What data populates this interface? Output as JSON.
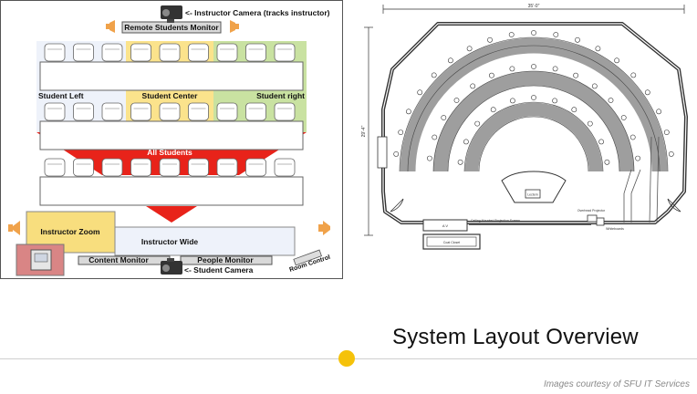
{
  "slide": {
    "title": "System Layout Overview",
    "credit": "Images courtesy of SFU IT Services",
    "accent_color": "#f5c20a"
  },
  "classroom": {
    "labels": {
      "instructor_camera": "<- Instructor Camera (tracks instructor)",
      "remote_monitor": "Remote Students Monitor",
      "student_left": "Student Left",
      "student_center": "Student Center",
      "student_right": "Student right",
      "all_students": "All Students",
      "instructor_zoom": "Instructor Zoom",
      "instructor_wide": "Instructor Wide",
      "content_monitor": "Content Monitor",
      "people_monitor": "People Monitor",
      "student_camera": "<- Student Camera",
      "room_control": "Room Control"
    },
    "zone_colors": {
      "left": "#eef2fa",
      "center": "#fbe38c",
      "right": "#c9e2a1",
      "all_students": "#e8231a",
      "instructor_zoom": "#f8de7e",
      "instructor_wide": "#eef2fa",
      "podium": "#d98585"
    }
  },
  "floorplan": {
    "dimension_width": "35'-0\"",
    "dimension_depth": "29'-4\"",
    "labels": {
      "lectern": "Lectern",
      "overhead_projector": "Overhead Projector",
      "av_cabinet": "A V",
      "projection_screen": "Ceiling Mounted Projection Screen",
      "whiteboards": "Whiteboards",
      "coat_closet": "Coat Closet"
    }
  }
}
